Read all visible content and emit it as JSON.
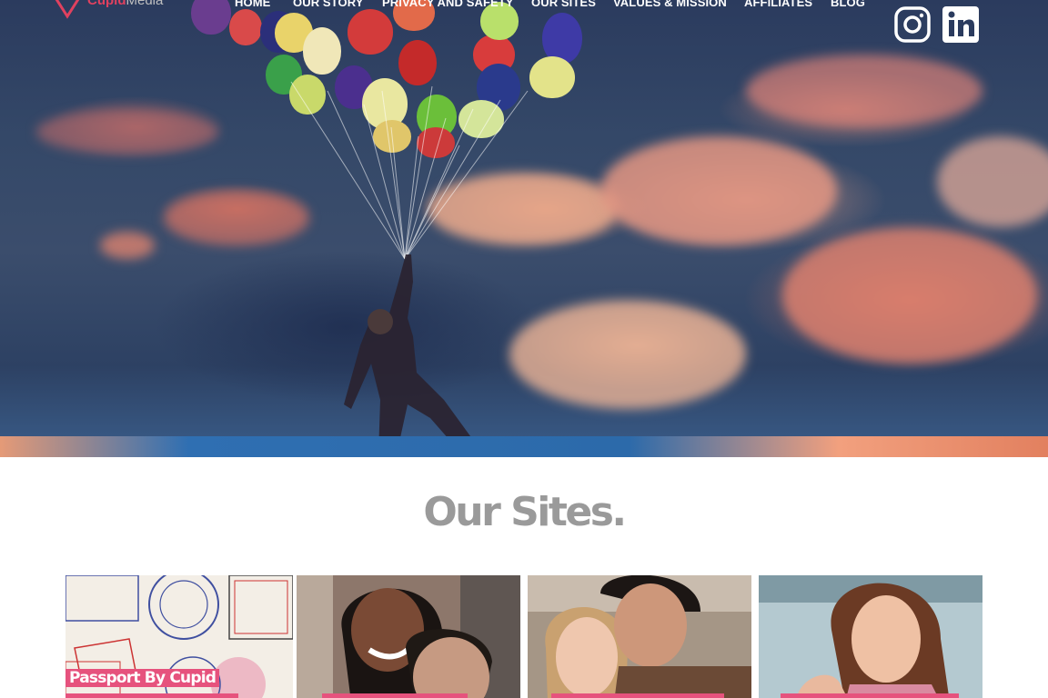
{
  "brand": {
    "name_primary": "Cupid",
    "name_secondary": "Media",
    "accent_color": "#e0415f"
  },
  "nav": {
    "items": [
      {
        "label": "HOME"
      },
      {
        "label": "OUR STORY"
      },
      {
        "label": "PRIVACY AND SAFETY"
      },
      {
        "label": "OUR SITES"
      },
      {
        "label": "VALUES & MISSION"
      },
      {
        "label": "AFFILIATES"
      },
      {
        "label": "BLOG"
      }
    ]
  },
  "social": {
    "icons": [
      "instagram-icon",
      "linkedin-icon"
    ],
    "linkedin_text": "in"
  },
  "hero": {
    "image_icon": "balloons-illustration"
  },
  "sites_section": {
    "title": "Our Sites.",
    "cards": [
      {
        "label": "Passport By Cupid"
      },
      {
        "label": ""
      },
      {
        "label": ""
      },
      {
        "label": ""
      }
    ],
    "label_color": "#e6527d"
  }
}
